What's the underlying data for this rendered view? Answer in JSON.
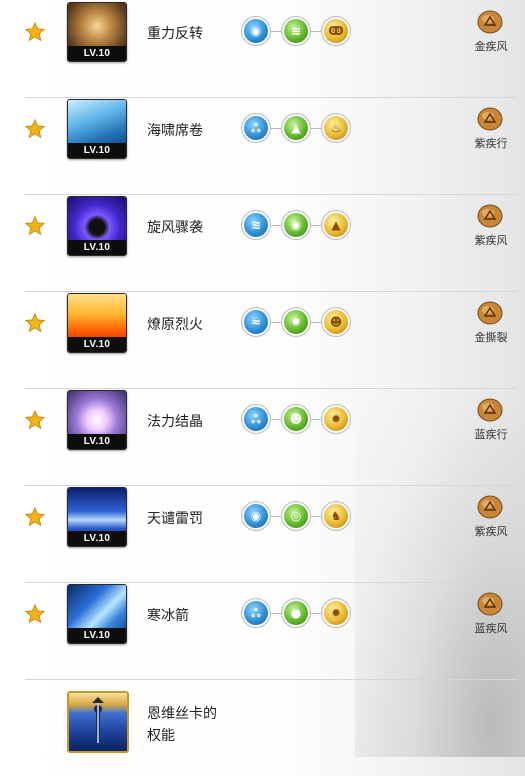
{
  "rows": [
    {
      "skill_name": "重力反转",
      "level": "LV.10",
      "runes": [
        "blue",
        "green",
        "gold"
      ],
      "rune_icons": [
        "eye-wings-rune-icon",
        "claws-rune-icon",
        "swirl-rune-icon"
      ],
      "gem_label": "金疾风",
      "gem_color": "#b8741f"
    },
    {
      "skill_name": "海啸席卷",
      "level": "LV.10",
      "runes": [
        "blue",
        "green",
        "gold"
      ],
      "rune_icons": [
        "splash-rune-icon",
        "arrow-up-rune-icon",
        "flame-rune-icon"
      ],
      "gem_label": "紫疾行",
      "gem_color": "#b8741f"
    },
    {
      "skill_name": "旋风骤袭",
      "level": "LV.10",
      "runes": [
        "blue",
        "green",
        "gold"
      ],
      "rune_icons": [
        "claws-rune-icon",
        "eye-wings-rune-icon",
        "arrow-up-rune-icon"
      ],
      "gem_label": "紫疾风",
      "gem_color": "#b8741f"
    },
    {
      "skill_name": "燎原烈火",
      "level": "LV.10",
      "runes": [
        "blue",
        "green",
        "gold"
      ],
      "rune_icons": [
        "wave-rune-icon",
        "sun-rune-icon",
        "head-rune-icon"
      ],
      "gem_label": "金撕裂",
      "gem_color": "#b8741f"
    },
    {
      "skill_name": "法力结晶",
      "level": "LV.10",
      "runes": [
        "blue",
        "green",
        "gold"
      ],
      "rune_icons": [
        "splash-rune-icon",
        "head-rune-icon",
        "sun-rune-icon"
      ],
      "gem_label": "蓝疾行",
      "gem_color": "#b8741f"
    },
    {
      "skill_name": "天谴雷罚",
      "level": "LV.10",
      "runes": [
        "blue",
        "green",
        "gold"
      ],
      "rune_icons": [
        "eye-wings-rune-icon",
        "ring-rune-icon",
        "wolf-rune-icon"
      ],
      "gem_label": "紫疾风",
      "gem_color": "#b8741f"
    },
    {
      "skill_name": "寒冰箭",
      "level": "LV.10",
      "runes": [
        "blue",
        "green",
        "gold"
      ],
      "rune_icons": [
        "splash-rune-icon",
        "orb-rune-icon",
        "sun-rune-icon"
      ],
      "gem_label": "蓝疾风",
      "gem_color": "#b8741f"
    }
  ],
  "passive": {
    "name_line1": "恩维丝卡的",
    "name_line2": "权能"
  },
  "colors": {
    "star": "#f2b21c",
    "rune_blue": "#2f8fd6",
    "rune_green": "#63b82c",
    "rune_gold": "#e8b830"
  }
}
